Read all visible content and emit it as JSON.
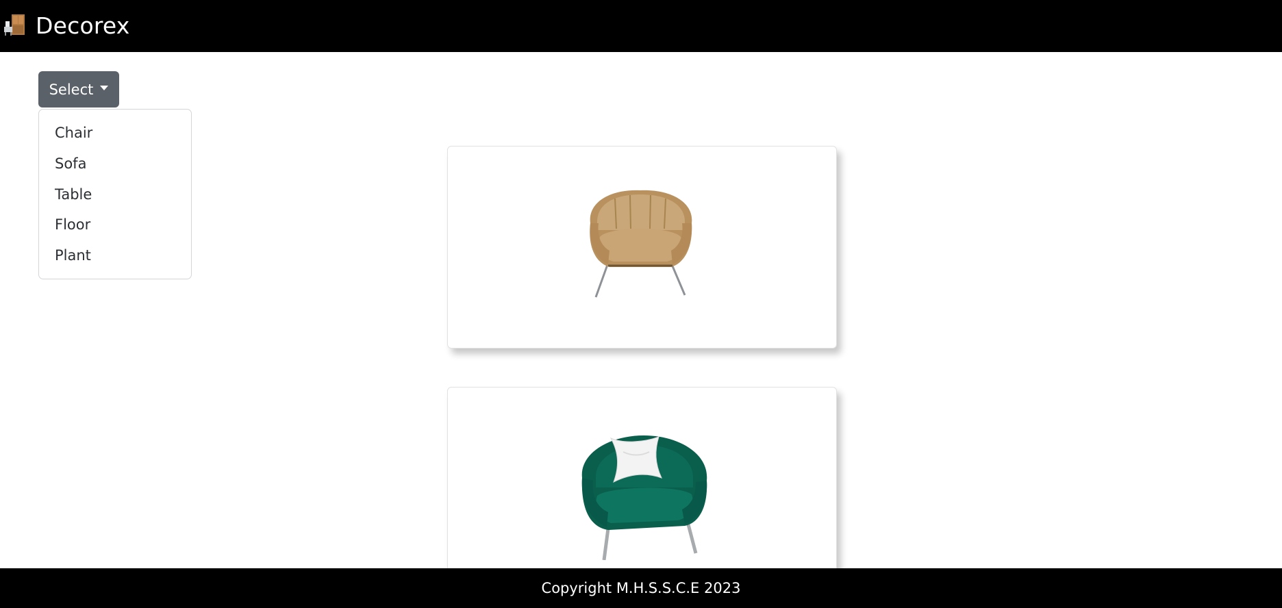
{
  "header": {
    "brand_name": "Decorex",
    "logo_icon": "furniture-logo-icon"
  },
  "category_select": {
    "button_label": "Select",
    "options": [
      "Chair",
      "Sofa",
      "Table",
      "Floor",
      "Plant"
    ]
  },
  "products": [
    {
      "image": "tan-leather-armchair"
    },
    {
      "image": "green-velvet-armchair-with-white-pillow"
    }
  ],
  "footer": {
    "copyright": "Copyright M.H.S.S.C.E 2023"
  },
  "colors": {
    "navbar": "#000000",
    "button": "#5a6168",
    "tan_chair": "#c9a779",
    "green_chair": "#0c6b57"
  }
}
